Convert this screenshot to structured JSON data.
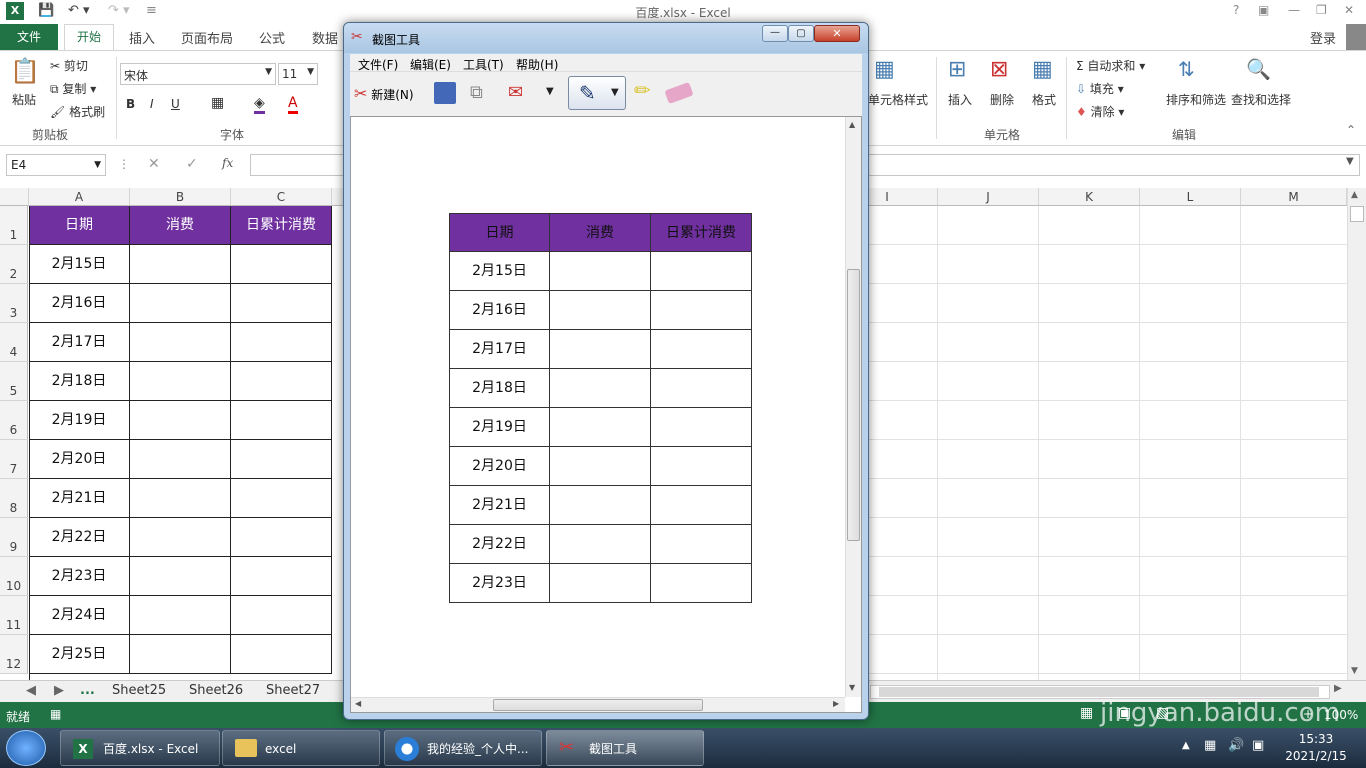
{
  "excel": {
    "title": "百度.xlsx - Excel",
    "help": "?",
    "login": "登录",
    "tabs": [
      "文件",
      "开始",
      "插入",
      "页面布局",
      "公式",
      "数据"
    ],
    "clipboard": {
      "paste": "粘贴",
      "cut": "剪切",
      "copy": "复制",
      "format_painter": "格式刷",
      "group": "剪贴板"
    },
    "font": {
      "name": "宋体",
      "size": "11",
      "group": "字体",
      "bold": "B",
      "italic": "I",
      "underline": "U",
      "font_color_letter": "A"
    },
    "cells_group": {
      "cell_style": "单元格样式",
      "insert": "插入",
      "delete": "删除",
      "format": "格式",
      "group": "单元格"
    },
    "editing": {
      "autosum": "自动求和",
      "fill": "填充",
      "clear": "清除",
      "sort": "排序和筛选",
      "find": "查找和选择",
      "group": "编辑"
    },
    "name_box": "E4",
    "fx": "fx",
    "columns_left": [
      "A",
      "B",
      "C"
    ],
    "columns_right": [
      "I",
      "J",
      "K",
      "L",
      "M"
    ],
    "rows": [
      "1",
      "2",
      "3",
      "4",
      "5",
      "6",
      "7",
      "8",
      "9",
      "10",
      "11",
      "12"
    ],
    "table_header": [
      "日期",
      "消费",
      "日累计消费"
    ],
    "dates": [
      "2月15日",
      "2月16日",
      "2月17日",
      "2月18日",
      "2月19日",
      "2月20日",
      "2月21日",
      "2月22日",
      "2月23日",
      "2月24日",
      "2月25日"
    ],
    "sheet_tabs": [
      "...",
      "Sheet25",
      "Sheet26",
      "Sheet27"
    ],
    "status": "就绪",
    "zoom": "100%",
    "watermark": "jingyan.baidu.com"
  },
  "snip": {
    "title": "截图工具",
    "menu": [
      "文件(F)",
      "编辑(E)",
      "工具(T)",
      "帮助(H)"
    ],
    "new_label": "新建(N)",
    "table_header": [
      "日期",
      "消费",
      "日累计消费"
    ],
    "dates": [
      "2月15日",
      "2月16日",
      "2月17日",
      "2月18日",
      "2月19日",
      "2月20日",
      "2月21日",
      "2月22日",
      "2月23日"
    ]
  },
  "taskbar": {
    "items": [
      "百度.xlsx - Excel",
      "excel",
      "我的经验_个人中...",
      "截图工具"
    ],
    "time": "15:33",
    "date": "2021/2/15"
  },
  "colors": {
    "excel_green": "#217346",
    "header_purple": "#7030a0"
  }
}
